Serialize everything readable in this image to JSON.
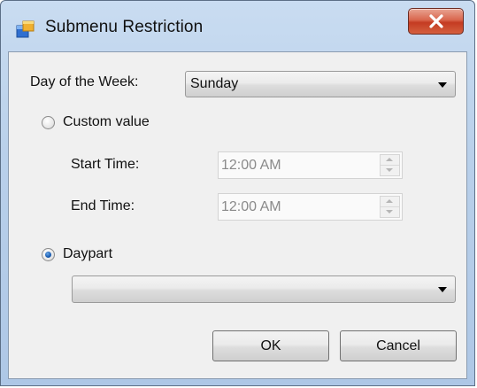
{
  "window": {
    "title": "Submenu Restriction",
    "close_glyph": "X"
  },
  "day_of_week": {
    "label": "Day of the Week:",
    "selected": "Sunday"
  },
  "custom_value": {
    "label": "Custom value",
    "checked": false,
    "start_time": {
      "label": "Start Time:",
      "value": "12:00 AM"
    },
    "end_time": {
      "label": "End Time:",
      "value": "12:00 AM"
    }
  },
  "daypart": {
    "label": "Daypart",
    "checked": true,
    "selected": ""
  },
  "buttons": {
    "ok": "OK",
    "cancel": "Cancel"
  },
  "icons": {
    "app": "app-window-icon",
    "close": "close-icon",
    "dropdown": "chevron-down-icon",
    "spin_up": "spin-up-icon",
    "spin_down": "spin-down-icon"
  },
  "colors": {
    "title_bar": "#c1d6ee",
    "close_button": "#c94a31",
    "client_area": "#f0f0f0",
    "radio_dot": "#1c5fb4",
    "disabled_text": "#8a8a8a"
  }
}
